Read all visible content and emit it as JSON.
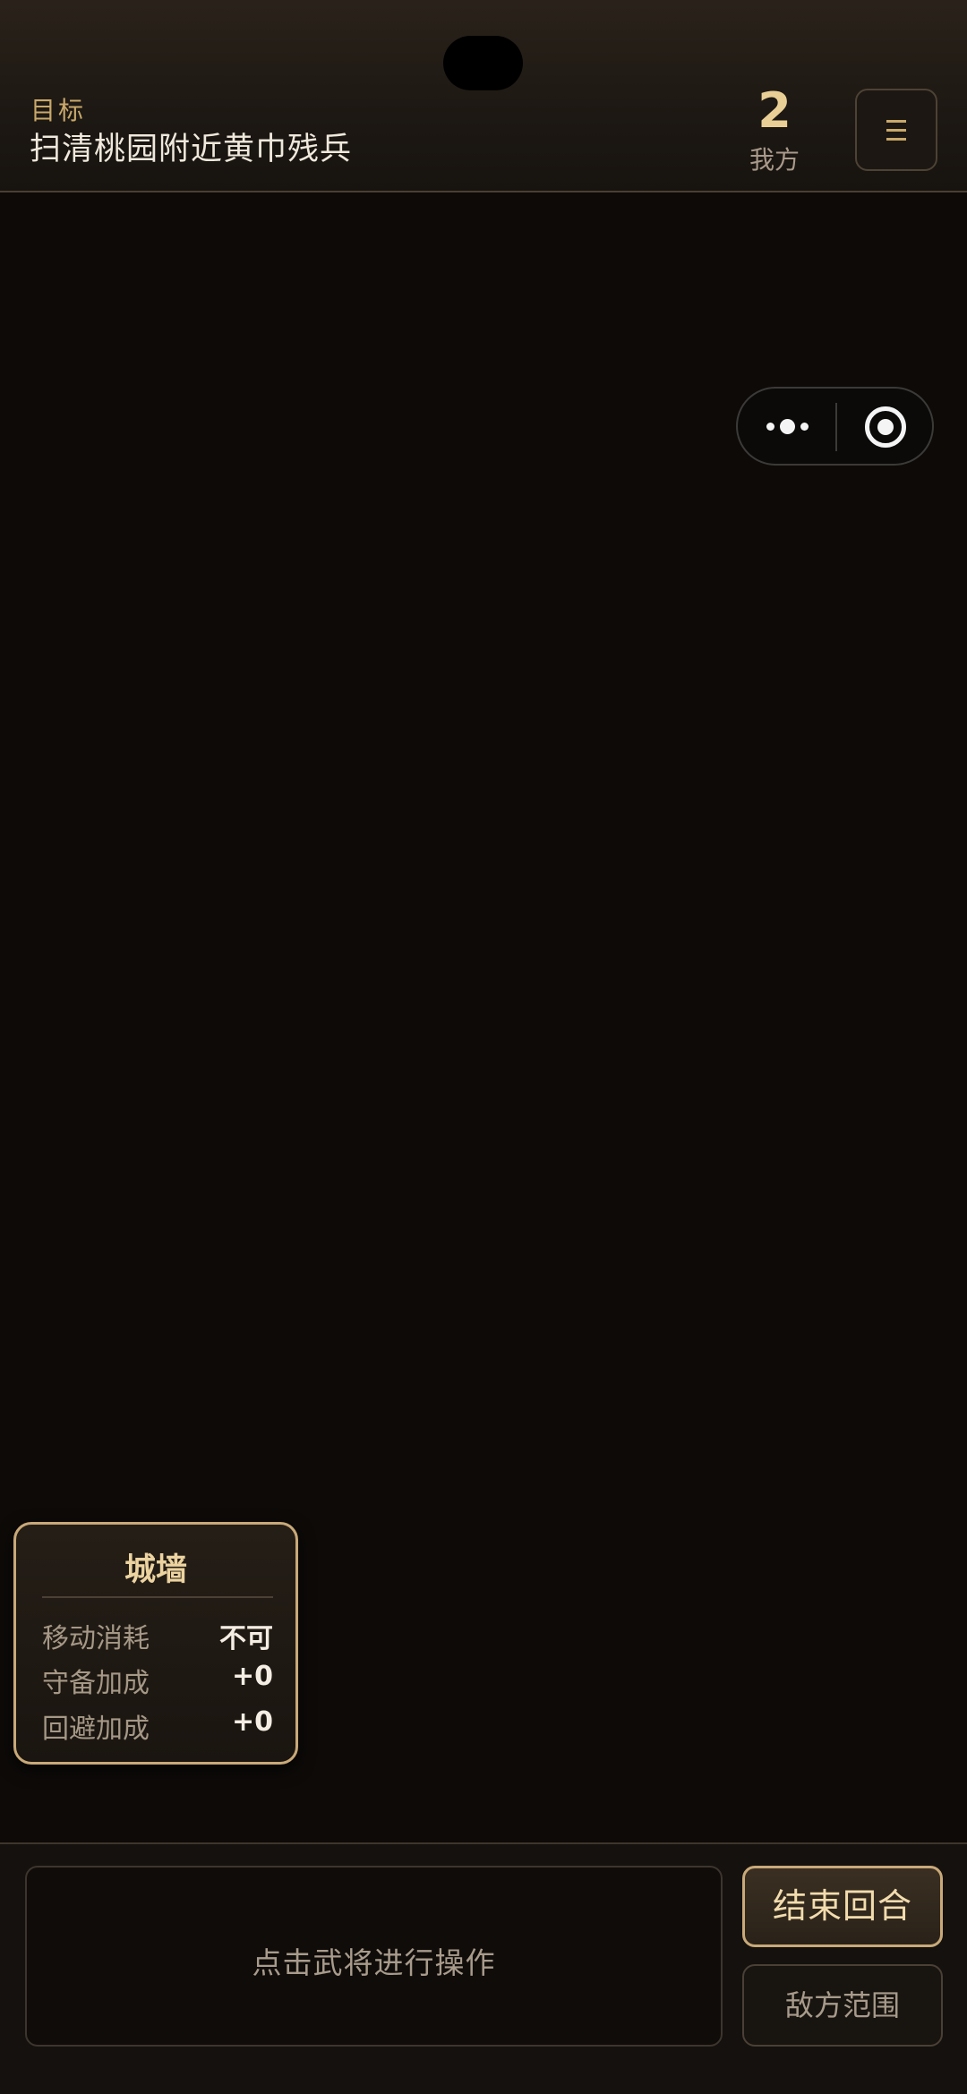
{
  "header": {
    "objective_label": "目标",
    "objective_text": "扫清桃园附近黄巾残兵",
    "turn_number": "2",
    "turn_side": "我方",
    "menu_icon": "hamburger-menu-icon"
  },
  "capsule": {
    "more_icon": "more-dots-icon",
    "close_icon": "close-target-icon"
  },
  "terrain_card": {
    "name": "城墙",
    "rows": [
      {
        "label": "移动消耗",
        "value": "不可"
      },
      {
        "label": "守备加成",
        "value": "+0"
      },
      {
        "label": "回避加成",
        "value": "+0"
      }
    ]
  },
  "bottom_bar": {
    "hint_text": "点击武将进行操作",
    "end_turn_label": "结束回合",
    "enemy_range_label": "敌方范围"
  },
  "colors": {
    "accent_gold": "#c9a979",
    "background": "#0d0a08"
  }
}
